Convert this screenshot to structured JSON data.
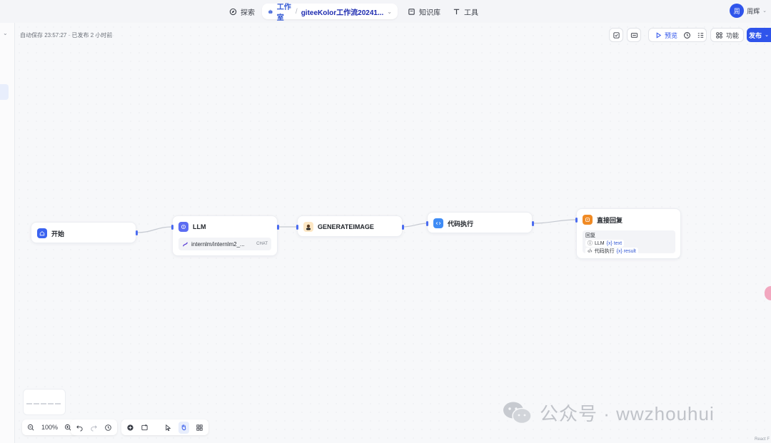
{
  "nav": {
    "explore": "探索",
    "studio": "工作室",
    "workflow_name": "giteeKolor工作流20241...",
    "knowledge": "知识库",
    "tools": "工具"
  },
  "user": {
    "avatar_text": "周",
    "name": "周辉"
  },
  "status": {
    "autosave": "自动保存 23:57:27 · 已发布 2 小时前"
  },
  "toolbar": {
    "preview": "预览",
    "features": "功能",
    "publish": "发布"
  },
  "nodes": {
    "start": {
      "title": "开始"
    },
    "llm": {
      "title": "LLM",
      "model": "internlm/internlm2_...",
      "model_tag": "CHAT"
    },
    "generate": {
      "title": "GENERATEIMAGE"
    },
    "code": {
      "title": "代码执行"
    },
    "reply": {
      "title": "直接回复",
      "label": "回复",
      "rows": [
        {
          "source": "LLM",
          "var": "{x} text"
        },
        {
          "source": "代码执行",
          "var": "{x} result"
        }
      ]
    }
  },
  "zoom": {
    "level": "100%"
  },
  "watermark": {
    "text": "公众号 · wwzhouhui"
  },
  "footnote": "React F",
  "colors": {
    "accent": "#2f54eb",
    "start": "#3b63f0",
    "llm": "#5b6cf2",
    "code": "#3f8cf5",
    "reply": "#f08a24"
  }
}
